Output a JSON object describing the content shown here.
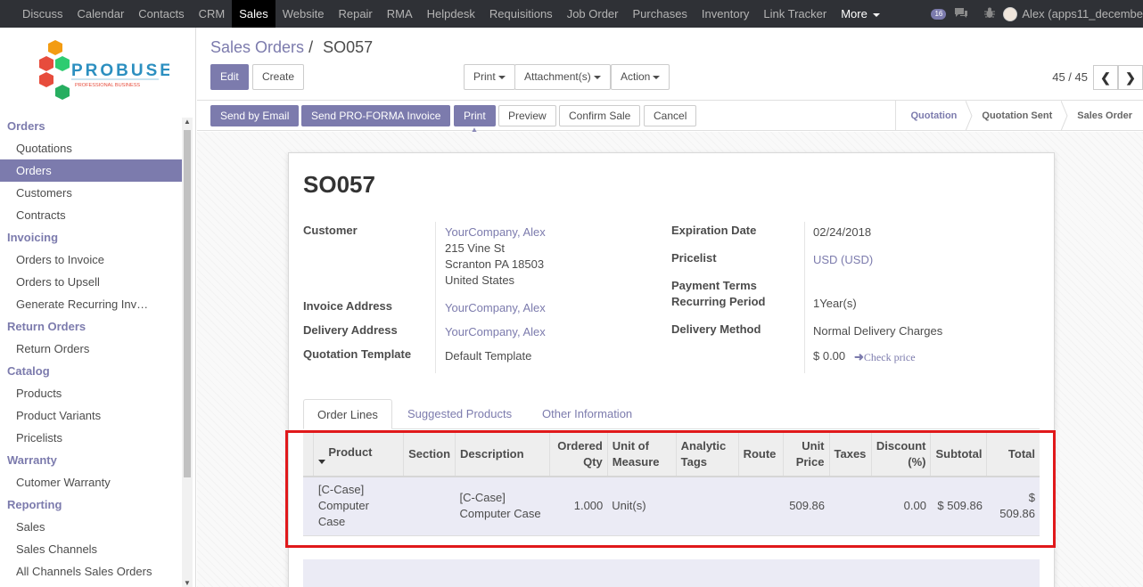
{
  "topnav": {
    "items": [
      "Discuss",
      "Calendar",
      "Contacts",
      "CRM",
      "Sales",
      "Website",
      "Repair",
      "RMA",
      "Helpdesk",
      "Requisitions",
      "Job Order",
      "Purchases",
      "Inventory",
      "Link Tracker"
    ],
    "active": "Sales",
    "more_label": "More",
    "notification_count": "16",
    "user": "Alex (apps11_decembe"
  },
  "logo": {
    "brand": "PROBUSE",
    "tagline": "PROFESSIONAL BUSINESS"
  },
  "sidebar": {
    "sections": [
      {
        "title": "Orders",
        "items": [
          "Quotations",
          "Orders",
          "Customers",
          "Contracts"
        ]
      },
      {
        "title": "Invoicing",
        "items": [
          "Orders to Invoice",
          "Orders to Upsell",
          "Generate Recurring Inv…"
        ]
      },
      {
        "title": "Return Orders",
        "items": [
          "Return Orders"
        ]
      },
      {
        "title": "Catalog",
        "items": [
          "Products",
          "Product Variants",
          "Pricelists"
        ]
      },
      {
        "title": "Warranty",
        "items": [
          "Cutomer Warranty"
        ]
      },
      {
        "title": "Reporting",
        "items": [
          "Sales",
          "Sales Channels",
          "All Channels Sales Orders"
        ]
      }
    ],
    "active_item": "Orders"
  },
  "breadcrumb": {
    "parent": "Sales Orders",
    "separator": "/",
    "current": "SO057"
  },
  "actions": {
    "edit": "Edit",
    "create": "Create",
    "print": "Print",
    "attachments": "Attachment(s)",
    "action": "Action"
  },
  "pager": {
    "value": "45 / 45",
    "prev": "❮",
    "next": "❯"
  },
  "statusbar": {
    "buttons": [
      "Send by Email",
      "Send PRO-FORMA Invoice",
      "Print",
      "Preview",
      "Confirm Sale",
      "Cancel"
    ],
    "stages": [
      "Quotation",
      "Quotation Sent",
      "Sales Order"
    ],
    "active_stage": "Quotation"
  },
  "record": {
    "name": "SO057",
    "customer_label": "Customer",
    "customer_name": "YourCompany, Alex",
    "customer_address": [
      "215 Vine St",
      "Scranton PA 18503",
      "United States"
    ],
    "invoice_address_label": "Invoice Address",
    "invoice_address": "YourCompany, Alex",
    "delivery_address_label": "Delivery Address",
    "delivery_address": "YourCompany, Alex",
    "quotation_template_label": "Quotation Template",
    "quotation_template": "Default Template",
    "expiration_date_label": "Expiration Date",
    "expiration_date": "02/24/2018",
    "pricelist_label": "Pricelist",
    "pricelist": "USD (USD)",
    "payment_terms_label": "Payment Terms",
    "recurring_period_label": "Recurring Period",
    "recurring_period": "1Year(s)",
    "delivery_method_label": "Delivery Method",
    "delivery_method": "Normal Delivery Charges",
    "delivery_price": "$ 0.00",
    "check_price": "Check price"
  },
  "tabs": [
    "Order Lines",
    "Suggested Products",
    "Other Information"
  ],
  "order_lines": {
    "columns": [
      "Product",
      "Section",
      "Description",
      "Ordered Qty",
      "Unit of Measure",
      "Analytic Tags",
      "Route",
      "Unit Price",
      "Taxes",
      "Discount (%)",
      "Subtotal",
      "Total"
    ],
    "rows": [
      {
        "product": "[C-Case] Computer Case",
        "section": "",
        "description": "[C-Case] Computer Case",
        "qty": "1.000",
        "uom": "Unit(s)",
        "analytic_tags": "",
        "route": "",
        "unit_price": "509.86",
        "taxes": "",
        "discount": "0.00",
        "subtotal": "$ 509.86",
        "total": "$ 509.86"
      }
    ]
  },
  "colors": {
    "accent": "#7c7bad",
    "topbar": "#2f3136",
    "highlight": "#e0191b"
  }
}
